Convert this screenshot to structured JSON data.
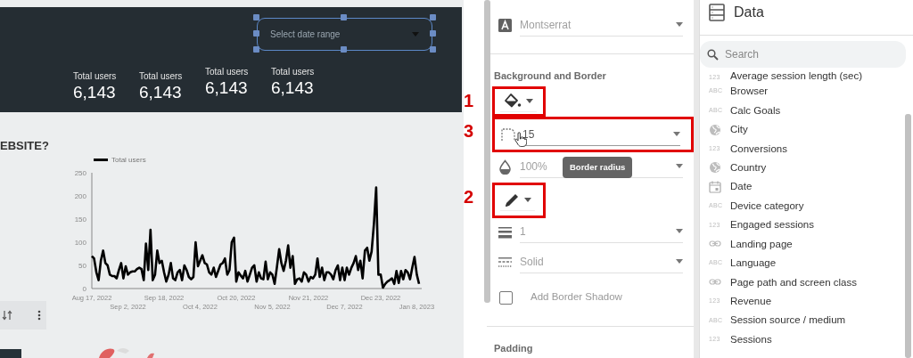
{
  "report": {
    "date_range": {
      "placeholder": "Select date range",
      "selected": true
    },
    "scorecards": [
      {
        "label": "Total users",
        "value": "6,143"
      },
      {
        "label": "Total users",
        "value": "6,143"
      },
      {
        "label": "Total users",
        "value": "6,143"
      },
      {
        "label": "Total users",
        "value": "6,143"
      }
    ],
    "heading": "EBSITE?",
    "chart_data": {
      "type": "line",
      "ylim": [
        0,
        250
      ],
      "yticks": [
        0,
        50,
        100,
        150,
        200,
        250
      ],
      "categories": [
        "Aug 17, 2022",
        null,
        null,
        null,
        null,
        null,
        null,
        null,
        null,
        null,
        null,
        null,
        null,
        null,
        null,
        null,
        "Sep 2, 2022",
        null,
        null,
        null,
        null,
        null,
        null,
        null,
        null,
        null,
        null,
        null,
        null,
        null,
        null,
        null,
        "Sep 18, 2022",
        null,
        null,
        null,
        null,
        null,
        null,
        null,
        null,
        null,
        null,
        null,
        null,
        null,
        null,
        null,
        "Oct 4, 2022",
        null,
        null,
        null,
        null,
        null,
        null,
        null,
        null,
        null,
        null,
        null,
        null,
        null,
        null,
        null,
        "Oct 20, 2022",
        null,
        null,
        null,
        null,
        null,
        null,
        null,
        null,
        null,
        null,
        null,
        null,
        null,
        null,
        null,
        "Nov 5, 2022",
        null,
        null,
        null,
        null,
        null,
        null,
        null,
        null,
        null,
        null,
        null,
        null,
        null,
        null,
        null,
        "Nov 21, 2022",
        null,
        null,
        null,
        null,
        null,
        null,
        null,
        null,
        null,
        null,
        null,
        null,
        null,
        null,
        null,
        "Dec 7, 2022",
        null,
        null,
        null,
        null,
        null,
        null,
        null,
        null,
        null,
        null,
        null,
        null,
        null,
        null,
        null,
        "Dec 23, 2022",
        null,
        null,
        null,
        null,
        null,
        null,
        null,
        null,
        null,
        null,
        null,
        null,
        null,
        null,
        null,
        "Jan 8, 2023",
        null
      ],
      "series": [
        {
          "name": "Total users",
          "color": "#000000",
          "values": [
            70,
            65,
            35,
            18,
            60,
            82,
            55,
            50,
            30,
            27,
            27,
            22,
            40,
            55,
            22,
            48,
            30,
            35,
            37,
            37,
            42,
            45,
            42,
            18,
            97,
            40,
            127,
            18,
            30,
            82,
            55,
            60,
            35,
            15,
            30,
            55,
            22,
            18,
            35,
            40,
            18,
            50,
            40,
            25,
            20,
            25,
            100,
            48,
            60,
            72,
            55,
            52,
            35,
            30,
            45,
            25,
            38,
            52,
            55,
            65,
            30,
            40,
            100,
            110,
            15,
            35,
            28,
            22,
            38,
            15,
            30,
            45,
            50,
            15,
            35,
            22,
            20,
            58,
            20,
            35,
            30,
            10,
            45,
            85,
            55,
            38,
            60,
            93,
            45,
            70,
            10,
            20,
            22,
            15,
            35,
            30,
            15,
            25,
            22,
            30,
            65,
            25,
            45,
            18,
            35,
            35,
            30,
            20,
            40,
            50,
            18,
            45,
            18,
            45,
            30,
            45,
            55,
            70,
            40,
            60,
            22,
            82,
            88,
            60,
            80,
            140,
            218,
            30,
            30,
            2,
            10,
            15,
            18,
            22,
            10,
            38,
            12,
            38,
            20,
            40,
            35,
            20,
            45,
            68,
            30,
            10
          ]
        }
      ]
    }
  },
  "style_panel": {
    "items": [
      {
        "kind": "fontpicker",
        "value": "Montserrat"
      },
      {
        "kind": "heading",
        "text": "Background and Border"
      },
      {
        "kind": "fillpicker",
        "callout": "1"
      },
      {
        "kind": "radius",
        "value": "15",
        "callout": "3",
        "tooltip": "Border radius"
      },
      {
        "kind": "opacity",
        "value": "100%"
      },
      {
        "kind": "pencolor",
        "callout": "2"
      },
      {
        "kind": "weight",
        "value": "1"
      },
      {
        "kind": "linestyle",
        "value": "Solid"
      },
      {
        "kind": "checkbox",
        "label": "Add Border Shadow",
        "checked": false
      },
      {
        "kind": "heading",
        "text": "Padding"
      }
    ]
  },
  "data_panel": {
    "title": "Data",
    "search": {
      "placeholder": "Search"
    },
    "fields": [
      {
        "kind": "number",
        "type_text": "123",
        "name": "Average session length (sec)"
      },
      {
        "kind": "text",
        "type_text": "ABC",
        "name": "Browser"
      },
      {
        "kind": "text",
        "type_text": "ABC",
        "name": "Calc Goals"
      },
      {
        "kind": "geo",
        "name": "City"
      },
      {
        "kind": "number",
        "type_text": "123",
        "name": "Conversions"
      },
      {
        "kind": "geo",
        "name": "Country"
      },
      {
        "kind": "date",
        "name": "Date"
      },
      {
        "kind": "text",
        "type_text": "ABC",
        "name": "Device category"
      },
      {
        "kind": "number",
        "type_text": "123",
        "name": "Engaged sessions"
      },
      {
        "kind": "url",
        "name": "Landing page"
      },
      {
        "kind": "text",
        "type_text": "ABC",
        "name": "Language"
      },
      {
        "kind": "url",
        "name": "Page path and screen class"
      },
      {
        "kind": "number",
        "type_text": "123",
        "name": "Revenue"
      },
      {
        "kind": "text",
        "type_text": "ABC",
        "name": "Session source / medium"
      },
      {
        "kind": "number",
        "type_text": "123",
        "name": "Sessions"
      }
    ]
  }
}
